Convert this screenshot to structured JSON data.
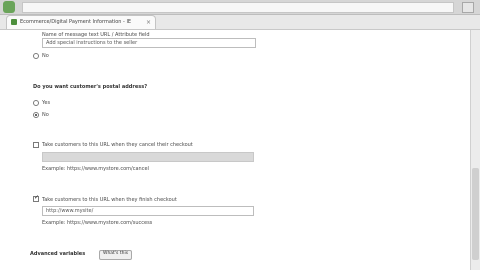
{
  "browser": {
    "tab_title": "Ecommerce/Digital Payment Information - IE",
    "tab_close": "×"
  },
  "form": {
    "top_field_label": "Name of message text URL / Attribute field",
    "top_field_value": "Add special instructions to the seller",
    "radio_no_label": "No",
    "shipping_question": "Do you want customer's postal address?",
    "shipping_yes": "Yes",
    "shipping_no": "No",
    "cancel_checkbox_label": "Take customers to this URL when they cancel their checkout",
    "cancel_example": "Example: https://www.mystore.com/cancel",
    "return_checkbox_label": "Take customers to this URL when they finish checkout",
    "return_value": "http://www.mysite/",
    "return_example": "Example: https://www.mystore.com/success",
    "advanced_label": "Advanced variables",
    "help_button": "What's this"
  }
}
